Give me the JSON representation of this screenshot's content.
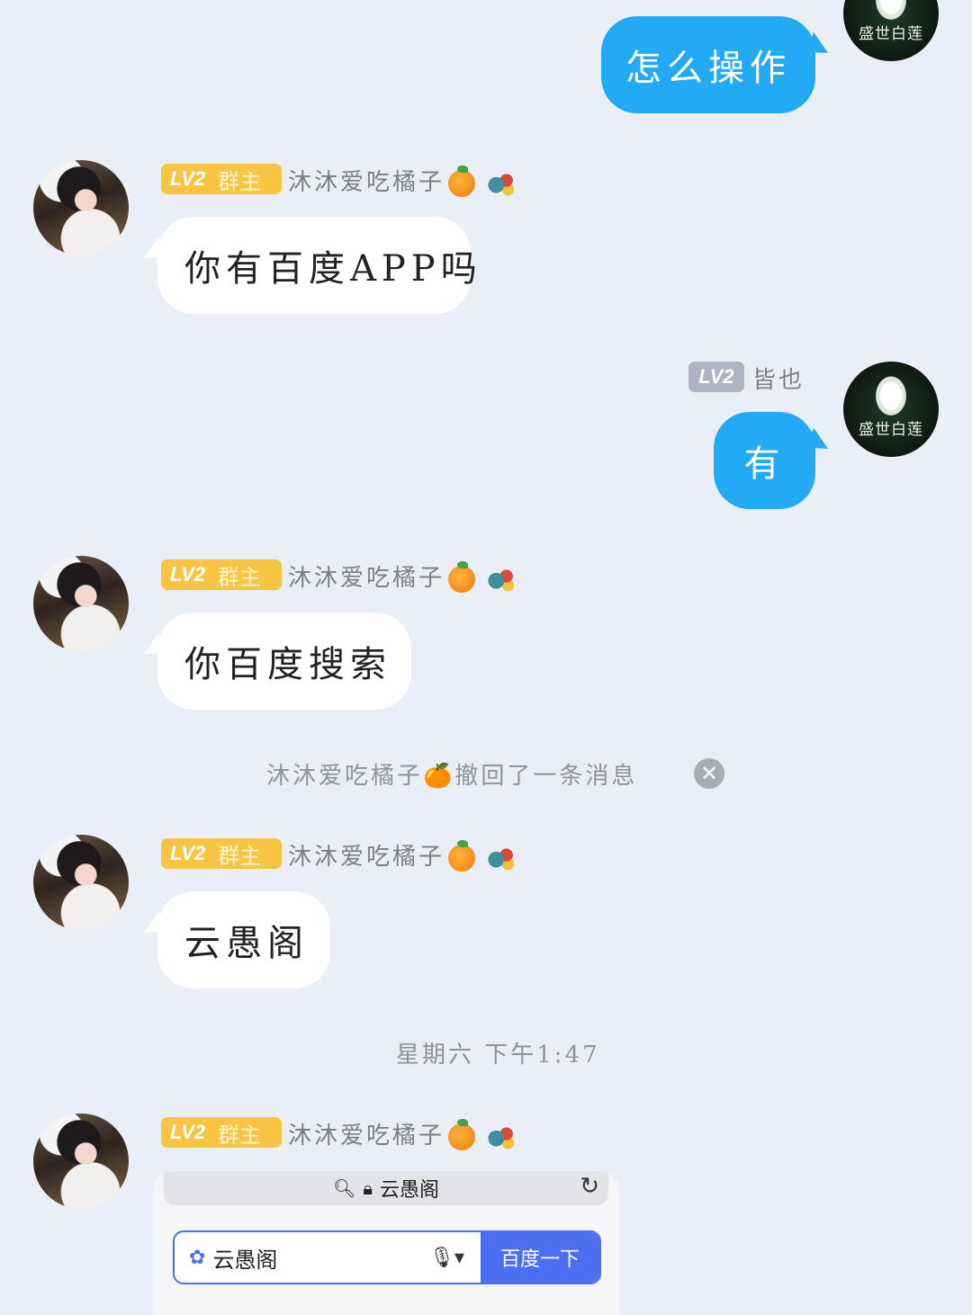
{
  "chat": {
    "messages": [
      {
        "side": "right",
        "text": "怎么操作"
      },
      {
        "side": "left",
        "level": "LV2",
        "role": "群主",
        "nickname": "沐沐爱吃橘子",
        "text": "你有百度APP吗"
      },
      {
        "side": "right",
        "level": "LV2",
        "nickname": "皆也",
        "text": "有"
      },
      {
        "side": "left",
        "level": "LV2",
        "role": "群主",
        "nickname": "沐沐爱吃橘子",
        "text": "你百度搜索"
      },
      {
        "side": "left",
        "level": "LV2",
        "role": "群主",
        "nickname": "沐沐爱吃橘子",
        "text": "云愚阁"
      },
      {
        "side": "left",
        "level": "LV2",
        "role": "群主",
        "nickname": "沐沐爱吃橘子"
      }
    ],
    "recall_notice": "沐沐爱吃橘子🍊撤回了一条消息",
    "timestamp": "星期六 下午1:47",
    "self_avatar_text": "盛世白莲"
  },
  "browser_card": {
    "url_text": "云愚阁",
    "search_query": "云愚阁",
    "search_button": "百度一下"
  },
  "colors": {
    "background": "#eaeef6",
    "self_bubble": "#22aaf5",
    "owner_badge": "#f7c542",
    "level_badge_gray": "#aeb4c2",
    "baidu_blue": "#4e6ef2"
  }
}
